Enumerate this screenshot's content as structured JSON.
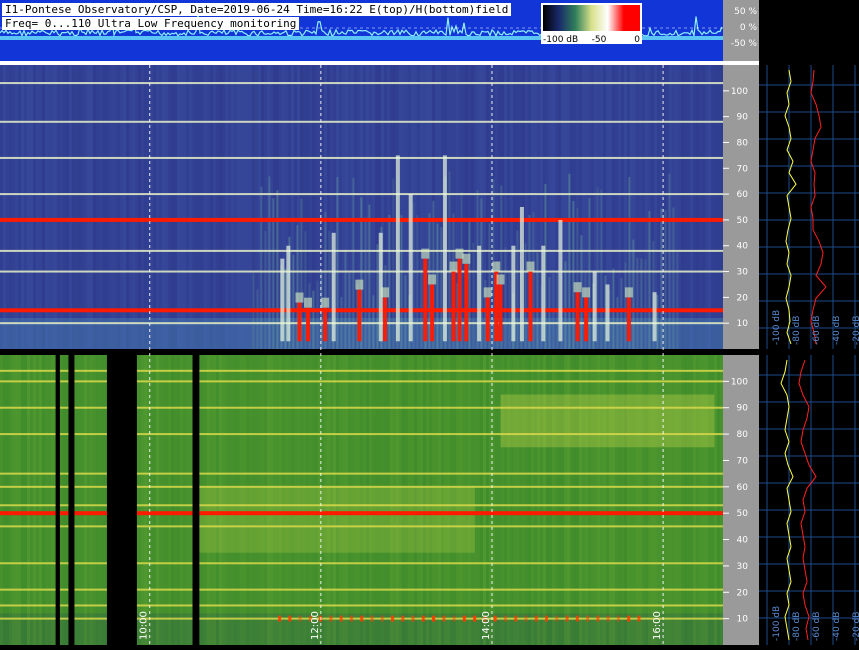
{
  "header": {
    "line1": "I1-Pontese Observatory/CSP, Date=2019-06-24 Time=16:22 E(top)/H(bottom)field",
    "line2": "Freq= 0...110 Ultra Low Frequency monitoring"
  },
  "colorbar": {
    "labels": [
      "-100 dB",
      "-50",
      "0"
    ],
    "stops": [
      "#000000",
      "#1a2a6c",
      "#2f7f5a",
      "#d8e08a",
      "#ffffff",
      "#ff0000",
      "#ff0000"
    ]
  },
  "amplitude_scale": {
    "labels": [
      "50 %",
      "0 %",
      "-50 %"
    ]
  },
  "time_axis": {
    "labels": [
      "10:00",
      "12:00",
      "14:00",
      "16:00"
    ],
    "hours": [
      10,
      12,
      14,
      16
    ]
  },
  "freq_axis": {
    "labels": [
      "10",
      "20",
      "30",
      "40",
      "50",
      "60",
      "70",
      "80",
      "90",
      "100"
    ],
    "min": 0,
    "max": 110
  },
  "profile_axis": {
    "labels": [
      "-100 dB",
      "-80 dB",
      "-60 dB",
      "-40 dB",
      "-20 dB"
    ]
  },
  "chart_data": [
    {
      "type": "heatmap",
      "panel": "E-field (top)",
      "x_unit": "hour of day",
      "xlim": [
        8.25,
        16.7
      ],
      "ylim": [
        0,
        110
      ],
      "y_unit": "Hz",
      "lines_hz": [
        10,
        15,
        30,
        38,
        50,
        60,
        74,
        88,
        103
      ],
      "strong_lines_hz": [
        15,
        50
      ],
      "colors": {
        "bg": "#2e3a8c",
        "bg_low": "#3f6aa0",
        "line": "#e8f0c8",
        "hot": "#ff1a00"
      },
      "bursts": [
        {
          "t": 11.55,
          "f_top": 35,
          "hot": false
        },
        {
          "t": 11.62,
          "f_top": 40,
          "hot": false
        },
        {
          "t": 11.75,
          "f_top": 18,
          "hot": true
        },
        {
          "t": 11.85,
          "f_top": 16,
          "hot": true
        },
        {
          "t": 12.05,
          "f_top": 16,
          "hot": true
        },
        {
          "t": 12.15,
          "f_top": 45,
          "hot": false
        },
        {
          "t": 12.45,
          "f_top": 23,
          "hot": true
        },
        {
          "t": 12.7,
          "f_top": 45,
          "hot": false
        },
        {
          "t": 12.75,
          "f_top": 20,
          "hot": true
        },
        {
          "t": 12.9,
          "f_top": 75,
          "hot": false
        },
        {
          "t": 13.05,
          "f_top": 60,
          "hot": false
        },
        {
          "t": 13.22,
          "f_top": 35,
          "hot": true
        },
        {
          "t": 13.3,
          "f_top": 25,
          "hot": true
        },
        {
          "t": 13.45,
          "f_top": 75,
          "hot": false
        },
        {
          "t": 13.55,
          "f_top": 30,
          "hot": true
        },
        {
          "t": 13.62,
          "f_top": 35,
          "hot": true
        },
        {
          "t": 13.7,
          "f_top": 33,
          "hot": true
        },
        {
          "t": 13.85,
          "f_top": 40,
          "hot": false
        },
        {
          "t": 13.95,
          "f_top": 20,
          "hot": true
        },
        {
          "t": 14.05,
          "f_top": 30,
          "hot": true
        },
        {
          "t": 14.1,
          "f_top": 25,
          "hot": true
        },
        {
          "t": 14.25,
          "f_top": 40,
          "hot": false
        },
        {
          "t": 14.35,
          "f_top": 55,
          "hot": false
        },
        {
          "t": 14.45,
          "f_top": 30,
          "hot": true
        },
        {
          "t": 14.6,
          "f_top": 40,
          "hot": false
        },
        {
          "t": 14.8,
          "f_top": 50,
          "hot": false
        },
        {
          "t": 15.0,
          "f_top": 22,
          "hot": true
        },
        {
          "t": 15.1,
          "f_top": 20,
          "hot": true
        },
        {
          "t": 15.2,
          "f_top": 30,
          "hot": false
        },
        {
          "t": 15.35,
          "f_top": 25,
          "hot": false
        },
        {
          "t": 15.6,
          "f_top": 20,
          "hot": true
        },
        {
          "t": 15.9,
          "f_top": 22,
          "hot": false
        }
      ]
    },
    {
      "type": "heatmap",
      "panel": "H-field (bottom)",
      "x_unit": "hour of day",
      "xlim": [
        8.25,
        16.7
      ],
      "ylim": [
        0,
        110
      ],
      "y_unit": "Hz",
      "lines_hz": [
        10,
        15,
        21,
        31,
        45,
        50,
        53,
        60,
        65,
        80,
        90,
        100,
        104
      ],
      "strong_lines_hz": [
        50
      ],
      "colors": {
        "bg": "#3c8a2c",
        "bg_low": "#2f6f3a",
        "line": "#d9d94a",
        "hot": "#ff1a00"
      },
      "gaps": [
        [
          8.9,
          8.95
        ],
        [
          9.05,
          9.12
        ],
        [
          9.5,
          9.85
        ],
        [
          10.5,
          10.58
        ]
      ],
      "bright_region": [
        14.1,
        16.6,
        75,
        95
      ]
    }
  ],
  "profiles": [
    {
      "panel": "E-field",
      "yellow_db": [
        -82,
        -80,
        -84,
        -82,
        -86,
        -82,
        -80,
        -84,
        -78,
        -82,
        -75,
        -84,
        -82,
        -80,
        -83,
        -85,
        -82,
        -84,
        -80,
        -82,
        -85,
        -82,
        -81,
        -84,
        -80
      ],
      "red_db": [
        -57,
        -58,
        -60,
        -55,
        -52,
        -50,
        -56,
        -58,
        -60,
        -56,
        -57,
        -56,
        -60,
        -58,
        -58,
        -52,
        -48,
        -50,
        -55,
        -45,
        -55,
        -58,
        -60,
        -57,
        -55
      ]
    },
    {
      "panel": "H-field",
      "yellow_db": [
        -84,
        -86,
        -90,
        -84,
        -82,
        -84,
        -86,
        -82,
        -86,
        -83,
        -78,
        -84,
        -82,
        -80,
        -84,
        -82,
        -80,
        -84,
        -82,
        -80,
        -84,
        -82,
        -86,
        -84,
        -82
      ],
      "red_db": [
        -66,
        -70,
        -72,
        -68,
        -62,
        -64,
        -68,
        -70,
        -66,
        -62,
        -55,
        -64,
        -68,
        -66,
        -70,
        -68,
        -66,
        -68,
        -66,
        -64,
        -68,
        -66,
        -62,
        -65,
        -63
      ]
    }
  ]
}
